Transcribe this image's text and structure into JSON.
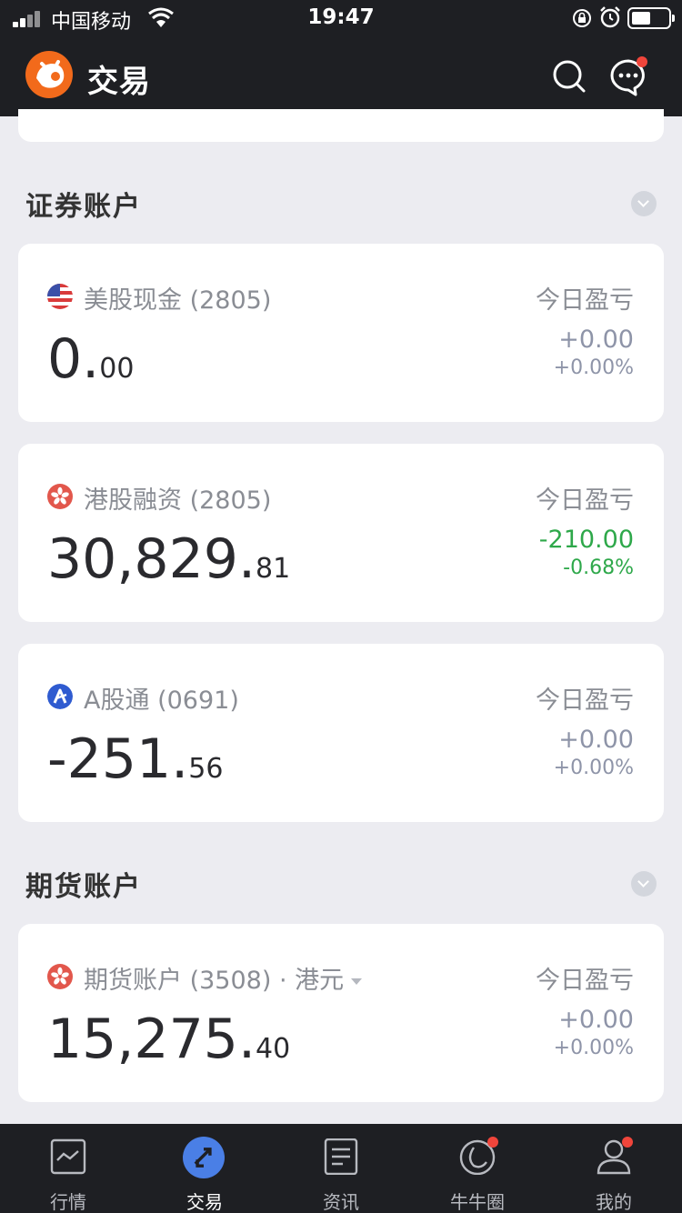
{
  "status_bar": {
    "carrier": "中国移动",
    "time": "19:47"
  },
  "header": {
    "title": "交易",
    "brand_color": "#f26a1b"
  },
  "sections": [
    {
      "title": "证券账户",
      "accounts": [
        {
          "icon": "us-flag-icon",
          "name": "美股现金",
          "number": "(2805)",
          "balance_int": "0.",
          "balance_dec": "00",
          "pnl_label": "今日盈亏",
          "pnl_amount": "+0.00",
          "pnl_pct": "+0.00%"
        },
        {
          "icon": "hk-flag-icon",
          "name": "港股融资",
          "number": "(2805)",
          "balance_int": "30,829.",
          "balance_dec": "81",
          "pnl_label": "今日盈亏",
          "pnl_amount": "-210.00",
          "pnl_pct": "-0.68%"
        },
        {
          "icon": "a-share-icon",
          "name": "A股通",
          "number": "(0691)",
          "balance_int": "-251.",
          "balance_dec": "56",
          "pnl_label": "今日盈亏",
          "pnl_amount": "+0.00",
          "pnl_pct": "+0.00%"
        }
      ]
    },
    {
      "title": "期货账户",
      "accounts": [
        {
          "icon": "hk-flag-icon",
          "name": "期货账户",
          "number": "(3508)",
          "currency": "· 港元",
          "balance_int": "15,275.",
          "balance_dec": "40",
          "pnl_label": "今日盈亏",
          "pnl_amount": "+0.00",
          "pnl_pct": "+0.00%"
        }
      ]
    }
  ],
  "tabs": [
    {
      "label": "行情",
      "icon": "market-chart-icon"
    },
    {
      "label": "交易",
      "icon": "trade-arrows-icon"
    },
    {
      "label": "资讯",
      "icon": "news-doc-icon"
    },
    {
      "label": "牛牛圈",
      "icon": "community-circle-icon"
    },
    {
      "label": "我的",
      "icon": "profile-user-icon"
    }
  ],
  "colors": {
    "negative": "#2ea84a",
    "neutral_pnl": "#8e94a8",
    "active_tab": "#4a7fe6",
    "badge": "#f0453b"
  }
}
